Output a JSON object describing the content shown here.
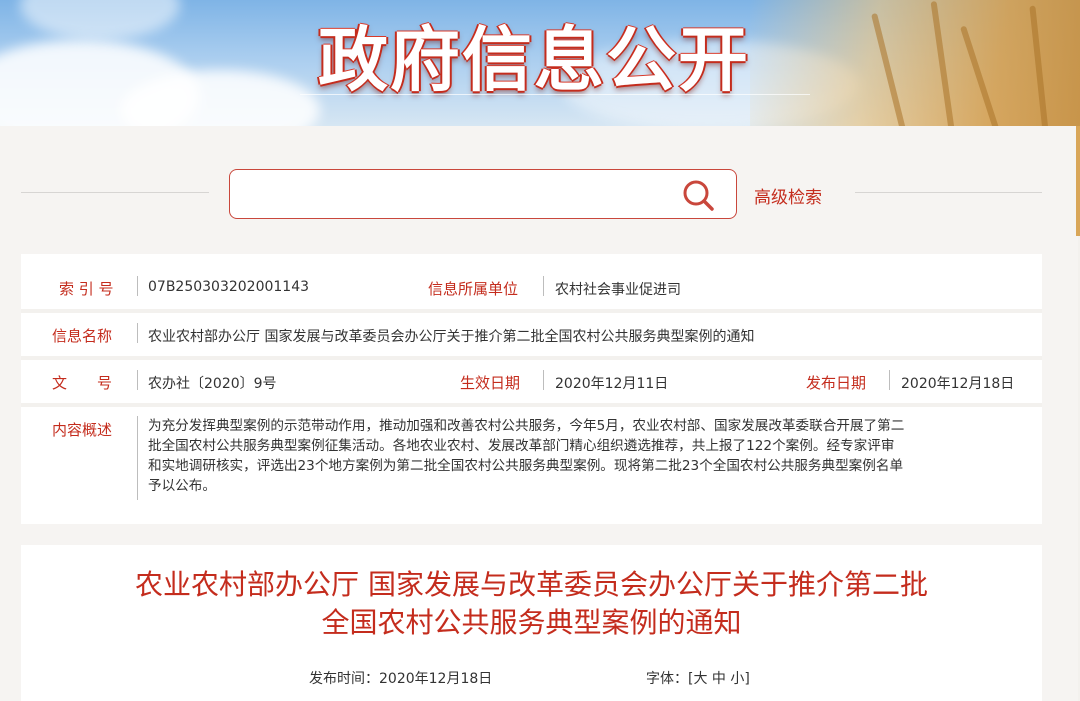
{
  "banner": {
    "title": "政府信息公开"
  },
  "search": {
    "input_value": "",
    "placeholder": "",
    "advanced_label": "高级检索"
  },
  "info": {
    "index_label": "索 引 号",
    "index_value": "07B250303202001143",
    "unit_label": "信息所属单位",
    "unit_value": "农村社会事业促进司",
    "name_label": "信息名称",
    "name_value": "农业农村部办公厅 国家发展与改革委员会办公厅关于推介第二批全国农村公共服务典型案例的通知",
    "docno_label": "文　　号",
    "docno_value": "农办社〔2020〕9号",
    "effective_label": "生效日期",
    "effective_value": "2020年12月11日",
    "publish_label": "发布日期",
    "publish_value": "2020年12月18日",
    "summary_label": "内容概述",
    "summary_lines": [
      "为充分发挥典型案例的示范带动作用，推动加强和改善农村公共服务，今年5月，农业农村部、国家发展改革委联合开展了第二",
      "批全国农村公共服务典型案例征集活动。各地农业农村、发展改革部门精心组织遴选推荐，共上报了122个案例。经专家评审",
      "和实地调研核实，评选出23个地方案例为第二批全国农村公共服务典型案例。现将第二批23个全国农村公共服务典型案例名单",
      "予以公布。"
    ]
  },
  "document": {
    "title_line1": "农业农村部办公厅 国家发展与改革委员会办公厅关于推介第二批",
    "title_line2": "全国农村公共服务典型案例的通知",
    "publish_time_label": "发布时间：",
    "publish_time_value": "2020年12月18日",
    "font_label": "字体：",
    "font_open": "[",
    "font_large": "大",
    "font_medium": "中",
    "font_small": "小",
    "font_close": "]"
  },
  "colors": {
    "accent": "#c42c1d",
    "border": "#c9473c",
    "background": "#f3f1ee"
  }
}
